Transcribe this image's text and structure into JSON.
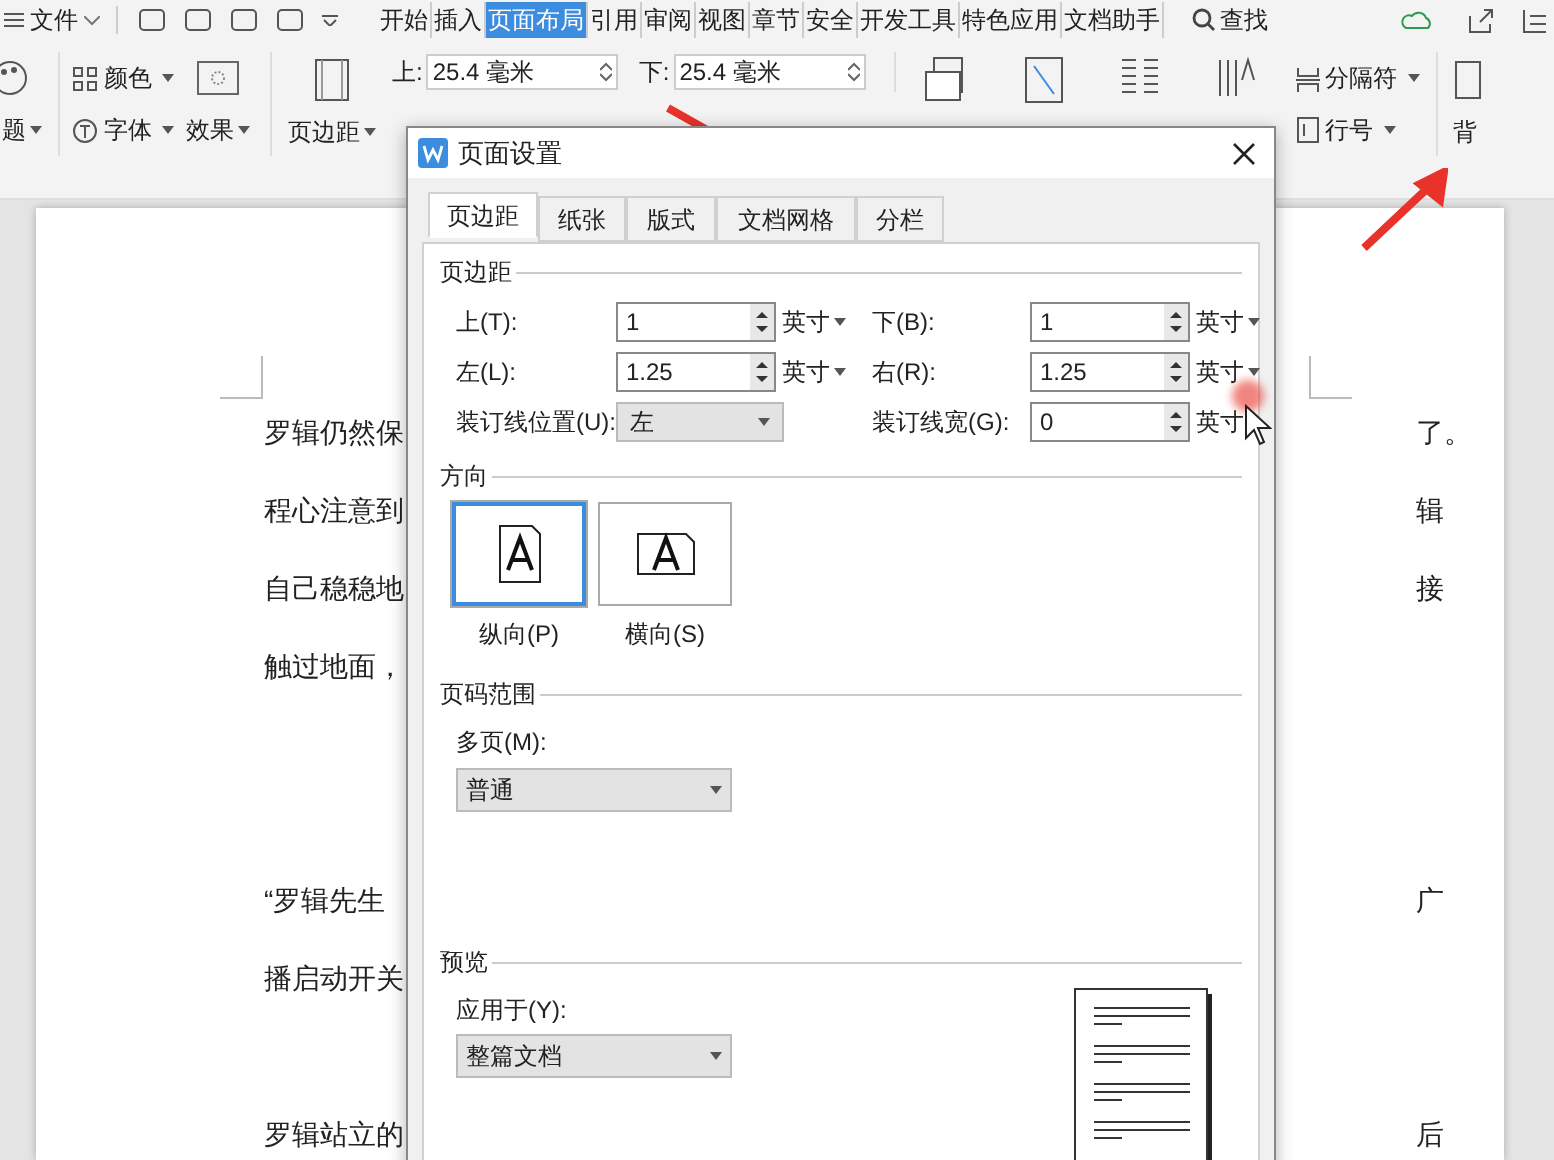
{
  "menu_bar": {
    "file_menu": "文件",
    "tabs": [
      {
        "label": "开始",
        "selected": false
      },
      {
        "label": "插入",
        "selected": false
      },
      {
        "label": "页面布局",
        "selected": true
      },
      {
        "label": "引用",
        "selected": false
      },
      {
        "label": "审阅",
        "selected": false
      },
      {
        "label": "视图",
        "selected": false
      },
      {
        "label": "章节",
        "selected": false
      },
      {
        "label": "安全",
        "selected": false
      },
      {
        "label": "开发工具",
        "selected": false
      },
      {
        "label": "特色应用",
        "selected": false
      },
      {
        "label": "文档助手",
        "selected": false
      }
    ],
    "search": "查找"
  },
  "ribbon": {
    "theme": "题",
    "colors": "颜色",
    "fonts": "字体",
    "effects": "效果",
    "margins": "页边距",
    "top_label": "上:",
    "top_value": "25.4 毫米",
    "bottom_label": "下:",
    "bottom_value": "25.4 毫米",
    "breaks": "分隔符",
    "line_numbers": "行号",
    "background": "背"
  },
  "document": {
    "blocks": [
      {
        "lines": [
          {
            "left": "罗辑仍然保",
            "right": "了。"
          },
          {
            "left": "程心注意到",
            "right": "辑"
          },
          {
            "left": "自己稳稳地",
            "right": "接"
          },
          {
            "left": "触过地面，"
          }
        ]
      },
      {
        "lines": [
          {
            "left": "“罗辑先生",
            "right": "广"
          },
          {
            "left": "播启动开关"
          }
        ]
      },
      {
        "lines": [
          {
            "left": "罗辑站立的",
            "right": "后"
          }
        ]
      }
    ]
  },
  "dialog": {
    "title": "页面设置",
    "tabs": [
      {
        "label": "页边距",
        "selected": true
      },
      {
        "label": "纸张",
        "selected": false
      },
      {
        "label": "版式",
        "selected": false
      },
      {
        "label": "文档网格",
        "selected": false
      },
      {
        "label": "分栏",
        "selected": false
      }
    ],
    "margins": {
      "heading": "页边距",
      "fields": [
        {
          "label": "上(T):",
          "value": "1",
          "unit": "英寸"
        },
        {
          "label": "下(B):",
          "value": "1",
          "unit": "英寸"
        },
        {
          "label": "左(L):",
          "value": "1.25",
          "unit": "英寸"
        },
        {
          "label": "右(R):",
          "value": "1.25",
          "unit": "英寸"
        }
      ],
      "gutter_position": {
        "label": "装订线位置(U):",
        "value": "左"
      },
      "gutter_width": {
        "label": "装订线宽(G):",
        "value": "0",
        "unit": "英寸"
      }
    },
    "orientation": {
      "heading": "方向",
      "options": [
        {
          "label": "纵向(P)",
          "selected": true
        },
        {
          "label": "横向(S)",
          "selected": false
        }
      ]
    },
    "page_range": {
      "heading": "页码范围",
      "label": "多页(M):",
      "value": "普通"
    },
    "preview": {
      "heading": "预览",
      "label": "应用于(Y):",
      "value": "整篇文档"
    }
  }
}
